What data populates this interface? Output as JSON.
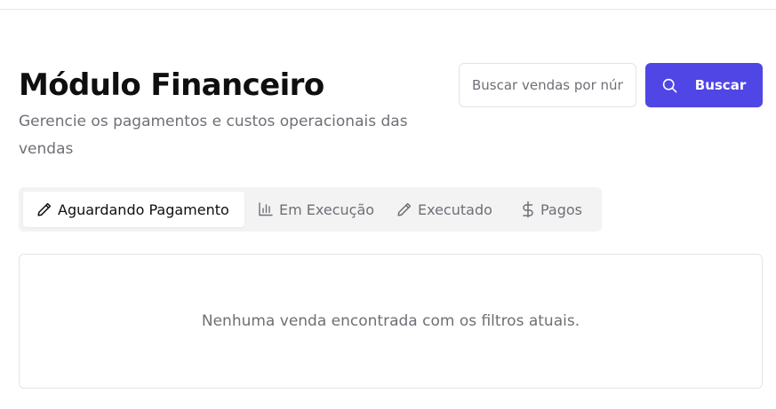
{
  "header": {
    "title": "Módulo Financeiro",
    "subtitle": "Gerencie os pagamentos e custos operacionais das vendas"
  },
  "search": {
    "placeholder": "Buscar vendas por número",
    "value": "",
    "button_label": "Buscar",
    "button_icon": "search-icon",
    "accent_color": "#4f46e5"
  },
  "tabs": [
    {
      "label": "Aguardando Pagamento",
      "icon": "pencil-icon",
      "active": true
    },
    {
      "label": "Em Execução",
      "icon": "bar-chart-icon",
      "active": false
    },
    {
      "label": "Executado",
      "icon": "pencil-icon",
      "active": false
    },
    {
      "label": "Pagos",
      "icon": "dollar-icon",
      "active": false
    }
  ],
  "results": {
    "empty_message": "Nenhuma venda encontrada com os filtros atuais."
  }
}
